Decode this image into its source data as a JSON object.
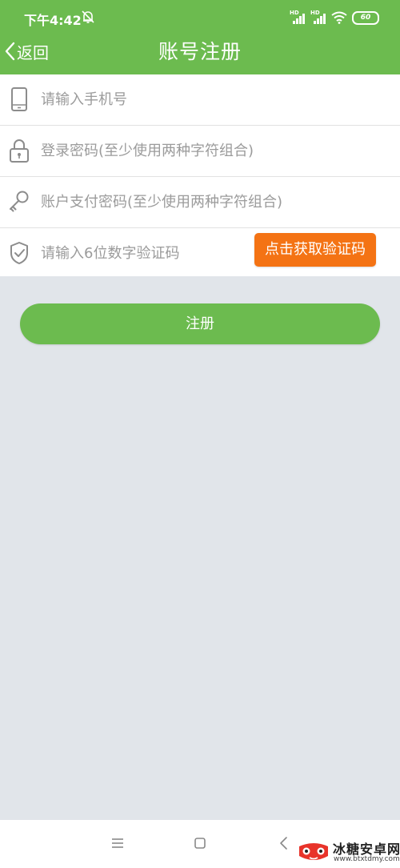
{
  "status_bar": {
    "time": "下午4:42",
    "battery": "60"
  },
  "header": {
    "back_label": "返回",
    "title": "账号注册"
  },
  "form": {
    "phone": {
      "placeholder": "请输入手机号",
      "icon": "phone-icon"
    },
    "password": {
      "placeholder": "登录密码(至少使用两种字符组合)",
      "icon": "lock-icon"
    },
    "pay_password": {
      "placeholder": "账户支付密码(至少使用两种字符组合)",
      "icon": "key-icon"
    },
    "code": {
      "placeholder": "请输入6位数字验证码",
      "icon": "shield-check-icon",
      "button_label": "点击获取验证码"
    }
  },
  "register_button": "注册",
  "watermark": {
    "name": "冰糖安卓网",
    "url": "www.btxtdmy.com"
  },
  "colors": {
    "primary": "#6cbb4f",
    "accent": "#f47314",
    "background": "#e1e5ea"
  }
}
